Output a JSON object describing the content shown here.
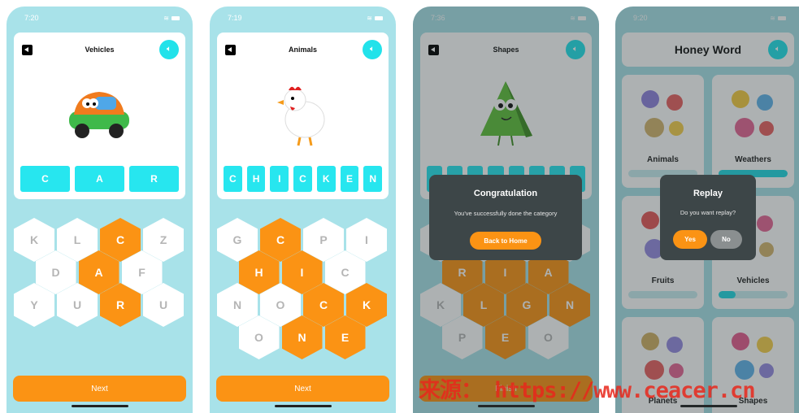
{
  "colors": {
    "background": "#a8e2e9",
    "accent_orange": "#fb9314",
    "accent_cyan": "#27e6ef",
    "modal": "#3d4648"
  },
  "games": [
    {
      "time": "7:20",
      "title": "Vehicles",
      "image": "car-image",
      "slots": [
        "C",
        "A",
        "R"
      ],
      "hex_rows": [
        [
          {
            "l": "K"
          },
          {
            "l": "L"
          },
          {
            "l": "C",
            "s": true
          },
          {
            "l": "Z"
          }
        ],
        [
          {
            "l": "D"
          },
          {
            "l": "A",
            "s": true
          },
          {
            "l": "F"
          }
        ],
        [
          {
            "l": "Y"
          },
          {
            "l": "U"
          },
          {
            "l": "R",
            "s": true
          },
          {
            "l": "U"
          }
        ]
      ],
      "button": "Next"
    },
    {
      "time": "7:19",
      "title": "Animals",
      "image": "chicken-image",
      "slots": [
        "C",
        "H",
        "I",
        "C",
        "K",
        "E",
        "N"
      ],
      "hex_rows": [
        [
          {
            "l": "G"
          },
          {
            "l": "C",
            "s": true
          },
          {
            "l": "P"
          },
          {
            "l": "I"
          }
        ],
        [
          {
            "l": "H",
            "s": true
          },
          {
            "l": "I",
            "s": true
          },
          {
            "l": "C"
          }
        ],
        [
          {
            "l": "N"
          },
          {
            "l": "O"
          },
          {
            "l": "C",
            "s": true
          },
          {
            "l": "K",
            "s": true
          }
        ],
        [
          {
            "l": "O"
          },
          {
            "l": "N",
            "s": true
          },
          {
            "l": "E",
            "s": true
          }
        ]
      ],
      "button": "Next"
    },
    {
      "time": "7:36",
      "title": "Shapes",
      "image": "triangle-image",
      "slots": [
        "",
        "",
        "",
        "",
        "",
        "",
        "",
        ""
      ],
      "hex_rows": [
        [
          {
            "l": ""
          },
          {
            "l": ""
          },
          {
            "l": ""
          },
          {
            "l": ""
          }
        ],
        [
          {
            "l": "R",
            "s": true
          },
          {
            "l": "I",
            "s": true
          },
          {
            "l": "A",
            "s": true
          }
        ],
        [
          {
            "l": "K"
          },
          {
            "l": "L",
            "s": true
          },
          {
            "l": "G",
            "s": true
          },
          {
            "l": "N",
            "s": true
          }
        ],
        [
          {
            "l": "P"
          },
          {
            "l": "E",
            "s": true
          },
          {
            "l": "O"
          }
        ]
      ],
      "button": "Finish",
      "dialog": {
        "title": "Congratulation",
        "message": "You've successfully done the category",
        "button": "Back to Home"
      }
    }
  ],
  "home": {
    "time": "9:20",
    "title": "Honey Word",
    "categories": [
      {
        "label": "Animals",
        "progress": 0
      },
      {
        "label": "Weathers",
        "progress": 1.0
      },
      {
        "label": "Fruits",
        "progress": 0
      },
      {
        "label": "Vehicles",
        "progress": 0.25
      },
      {
        "label": "Planets"
      },
      {
        "label": "Shapes"
      }
    ],
    "dialog": {
      "title": "Replay",
      "message": "Do you want replay?",
      "yes": "Yes",
      "no": "No"
    }
  },
  "watermark": "来源： https://www.ceacer.cn"
}
